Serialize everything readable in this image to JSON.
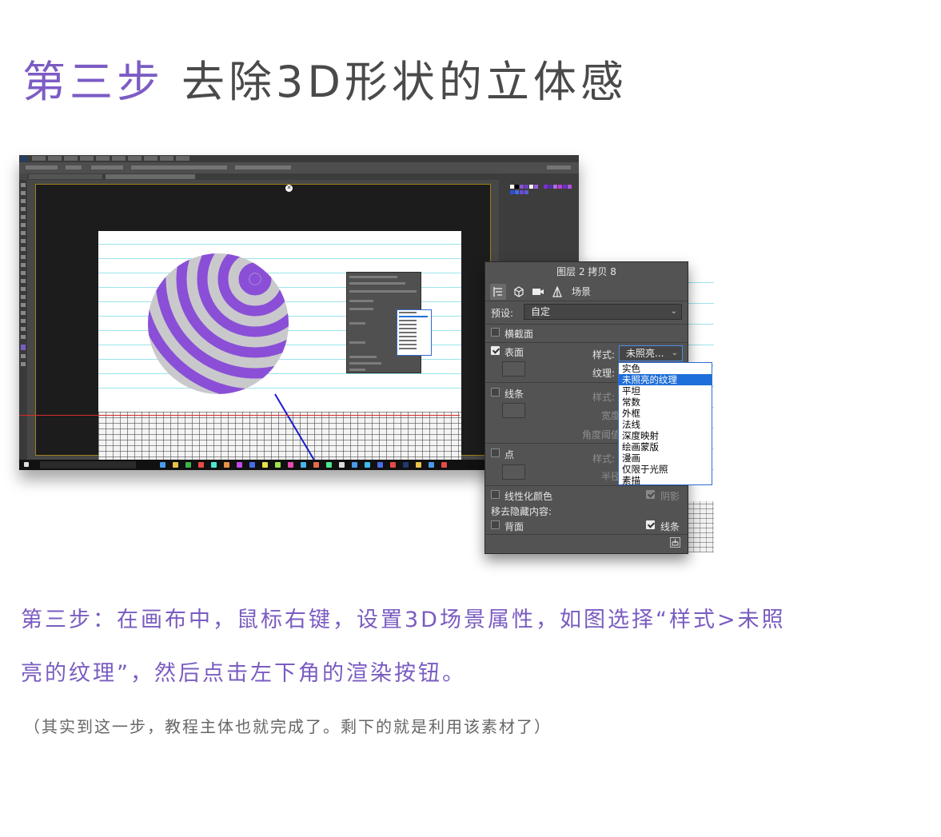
{
  "heading": {
    "step": "第三步",
    "title": "去除3D形状的立体感"
  },
  "panel": {
    "title": "图层 2 拷贝 8",
    "tab_scene": "场景",
    "preset_label": "预设:",
    "preset_value": "自定",
    "cross_section_label": "横截面",
    "surface_label": "表面",
    "style_label": "样式:",
    "style_value": "未照亮...",
    "texture_label": "纹理:",
    "lines_label": "线条",
    "lines_style_label": "样式:",
    "width_label": "宽度",
    "angle_threshold_label": "角度阈值",
    "points_label": "点",
    "points_style_label": "样式:",
    "radius_label": "半径",
    "linearize_colors_label": "线性化颜色",
    "shadows_label": "阴影",
    "remove_hidden_label": "移去隐藏内容:",
    "backfaces_label": "背面",
    "hidden_lines_label": "线条",
    "dropdown_options": [
      "实色",
      "未照亮的纹理",
      "平坦",
      "常数",
      "外框",
      "法线",
      "深度映射",
      "绘画蒙版",
      "漫画",
      "仅限于光照",
      "素描"
    ],
    "dropdown_selected": "未照亮的纹理"
  },
  "description": {
    "line1": "第三步：在画布中，鼠标右键，设置3D场景属性，如图选择“样式>未照",
    "line2": "亮的纹理”，然后点击左下角的渲染按钮。",
    "note": "（其实到这一步，教程主体也就完成了。剩下的就是利用该素材了）"
  },
  "colors": {
    "accent": "#7c5cc4",
    "sphere_stripe": "#8a4fd6",
    "sphere_band": "#c9c9cc",
    "highlight": "#1e6fd9"
  }
}
